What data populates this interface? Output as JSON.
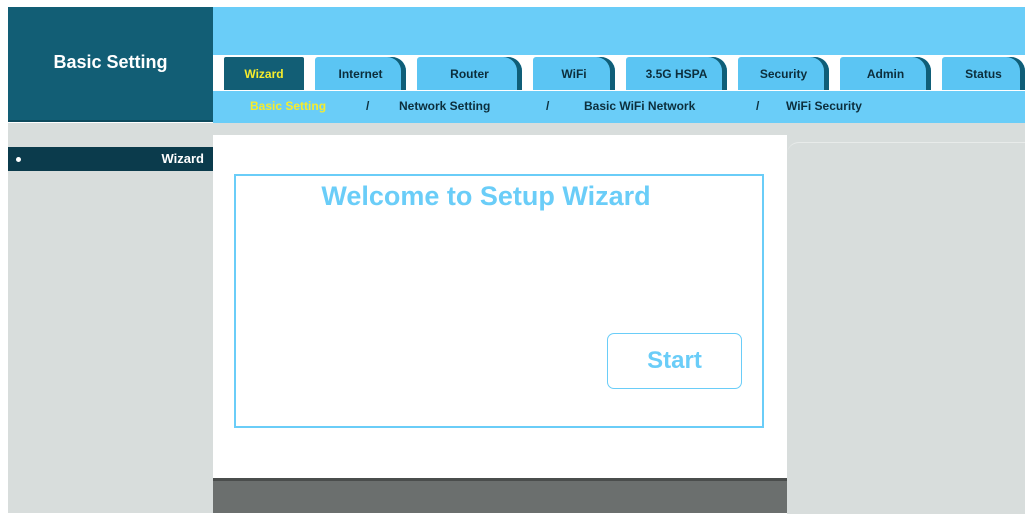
{
  "brand": {
    "title": "Basic Setting"
  },
  "tabs": [
    {
      "label": "Wizard",
      "active": true
    },
    {
      "label": "Internet"
    },
    {
      "label": "Router"
    },
    {
      "label": "WiFi"
    },
    {
      "label": "3.5G HSPA"
    },
    {
      "label": "Security"
    },
    {
      "label": "Admin"
    },
    {
      "label": "Status"
    }
  ],
  "subnav": {
    "items": [
      "Basic Setting",
      "Network Setting",
      "Basic WiFi Network",
      "WiFi Security"
    ],
    "separator": "/",
    "active_index": 0
  },
  "sidebar": {
    "items": [
      {
        "label": "Wizard",
        "icon": "bullet-icon"
      }
    ]
  },
  "main": {
    "title": "Welcome to Setup Wizard",
    "start_label": "Start"
  },
  "colors": {
    "header_band": "#6acdf8",
    "brand_dark": "#125e75",
    "active_text": "#f6ec2d",
    "panel_gray": "#d8dddc",
    "accent": "#6acdf8"
  }
}
